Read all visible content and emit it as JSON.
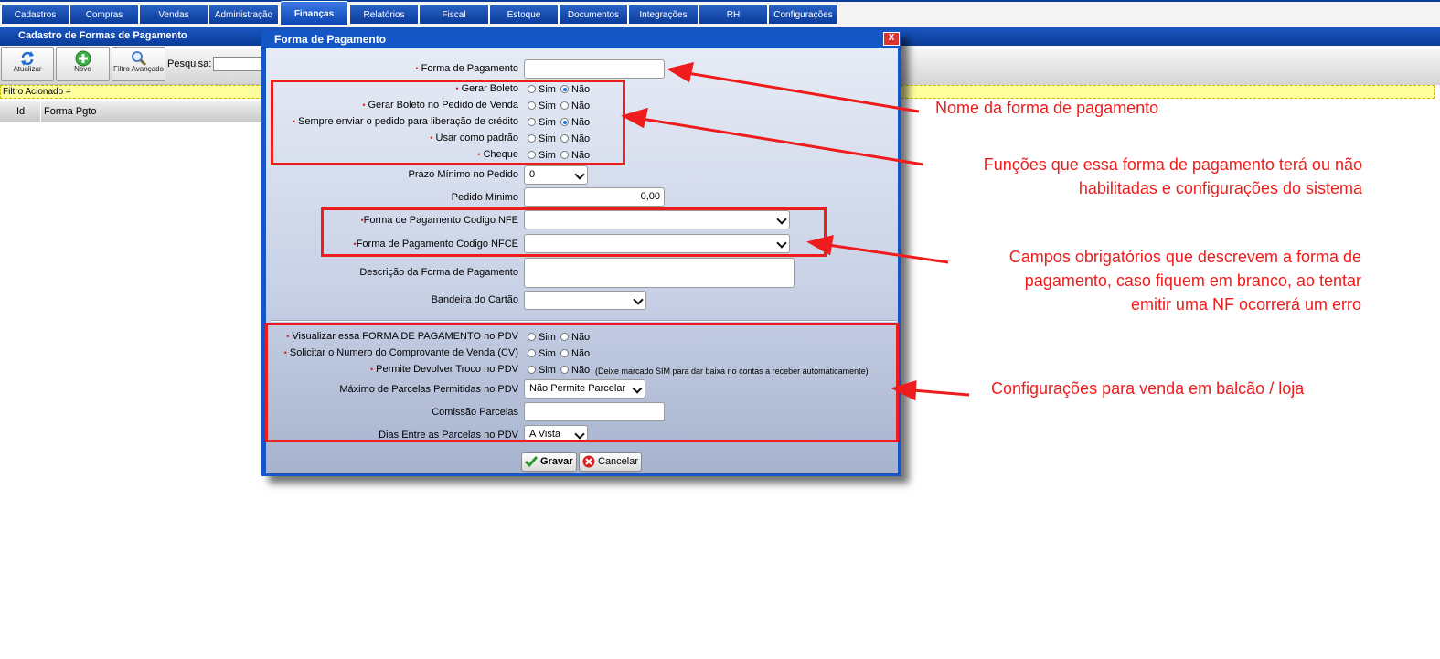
{
  "nav": {
    "tabs": [
      "Cadastros",
      "Compras",
      "Vendas",
      "Administração",
      "Finanças",
      "Relatórios",
      "Fiscal",
      "Estoque",
      "Documentos",
      "Integrações",
      "RH",
      "Configurações"
    ],
    "active": "Finanças"
  },
  "page": {
    "title": "Cadastro de Formas de Pagamento"
  },
  "toolbar": {
    "atualizar": "Atualizar",
    "novo": "Novo",
    "filtro": "Filtro Avançado",
    "pesquisa_label": "Pesquisa:"
  },
  "filter_bar": "Filtro Acionado =",
  "grid": {
    "col_id": "Id",
    "col_forma": "Forma Pgto"
  },
  "dialog": {
    "title": "Forma de Pagamento",
    "close": "X",
    "required_mark": "•",
    "labels": {
      "forma_pagamento": "Forma de Pagamento",
      "gerar_boleto": "Gerar Boleto",
      "gerar_boleto_pedido": "Gerar Boleto no Pedido de Venda",
      "liberacao_credito": "Sempre enviar o pedido para liberação de crédito",
      "usar_padrao": "Usar como padrão",
      "cheque": "Cheque",
      "prazo_minimo": "Prazo Mínimo no Pedido",
      "pedido_minimo": "Pedido Mínimo",
      "codigo_nfe": "Forma de Pagamento Codigo NFE",
      "codigo_nfce": "Forma de Pagamento Codigo NFCE",
      "descricao": "Descrição da Forma de Pagamento",
      "bandeira": "Bandeira do Cartão",
      "visualizar_pdv": "Visualizar essa FORMA DE PAGAMENTO no PDV",
      "solicitar_cv": "Solicitar o Numero do Comprovante de Venda (CV)",
      "devolver_troco": "Permite Devolver Troco no PDV",
      "max_parcelas": "Máximo de Parcelas Permitidas no PDV",
      "comissao": "Comissão Parcelas",
      "dias_parcelas": "Dias Entre as Parcelas no PDV"
    },
    "radio_sim": "Sim",
    "radio_nao": "Não",
    "values": {
      "forma_pagamento": "",
      "prazo_minimo": "0",
      "pedido_minimo": "0,00",
      "codigo_nfe": "",
      "codigo_nfce": "",
      "descricao": "",
      "bandeira": "",
      "max_parcelas": "Não Permite Parcelar",
      "comissao": "",
      "dias_parcelas": "A Vista"
    },
    "troco_hint": "(Deixe marcado SIM para dar baixa no contas a receber automaticamente)",
    "buttons": {
      "gravar": "Gravar",
      "cancelar": "Cancelar"
    }
  },
  "annotations": {
    "nome": "Nome da forma de pagamento",
    "funcoes_1": "Funções que essa forma de pagamento terá ou não",
    "funcoes_2": "habilitadas e configurações do sistema",
    "campos_1": "Campos obrigatórios que descrevem a forma de",
    "campos_2": "pagamento, caso fiquem em branco, ao tentar",
    "campos_3": "emitir uma NF ocorrerá um erro",
    "config": "Configurações para venda em balcão / loja"
  },
  "colors": {
    "accent": "#0a3c99",
    "annotation": "#ee1c1c"
  }
}
